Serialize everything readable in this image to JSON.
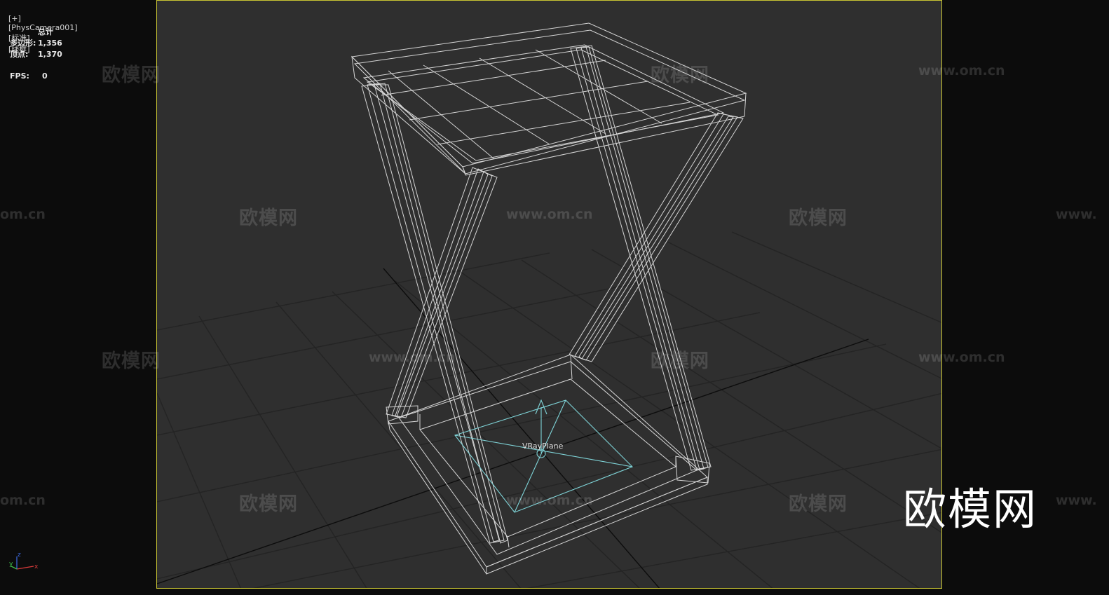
{
  "viewport_label": {
    "plus": "[+]",
    "camera": "[PhysCamera001]",
    "shading": "[标准]",
    "mode": "[线框]"
  },
  "stats": {
    "total_label": "总计",
    "polygons_label": "多边形:",
    "polygons_value": "1,356",
    "vertices_label": "顶点:",
    "vertices_value": "1,370",
    "fps_label": "FPS:",
    "fps_value": "0"
  },
  "scene": {
    "light_label": "VRayPlane"
  },
  "watermark": {
    "cn": "欧模网",
    "url": "www.om.cn",
    "url_part_left": "om.cn",
    "url_part_right": "www."
  },
  "logo": {
    "text": "欧模网"
  },
  "gizmo": {
    "x": "x",
    "y": "y",
    "z": "z"
  },
  "colors": {
    "viewport_bg": "#2f2f2f",
    "viewport_border": "#c9c533",
    "wireframe": "#e8e8e8",
    "light": "#7fd4d8",
    "grid": "#262626"
  }
}
